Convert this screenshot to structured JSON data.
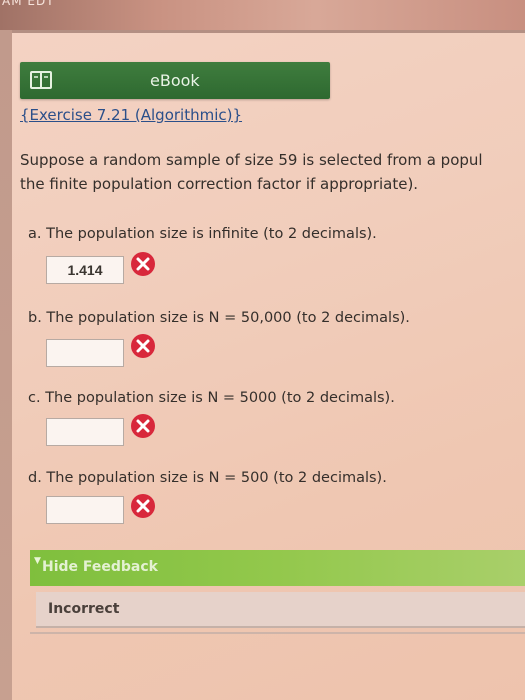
{
  "top_label": "AM EDT",
  "ebook": {
    "label": "eBook",
    "icon": "book-icon"
  },
  "exercise_title": "{Exercise 7.21 (Algorithmic)}",
  "question": {
    "line1": "Suppose a random sample of size 59 is selected from a popul",
    "line2": "the finite population correction factor if appropriate)."
  },
  "parts": [
    {
      "label": "a. The population size is infinite (to 2 decimals).",
      "value": "1.414",
      "status": "incorrect"
    },
    {
      "label": "b. The population size is N = 50,000 (to 2 decimals).",
      "value": "",
      "status": "incorrect"
    },
    {
      "label": "c. The population size is N = 5000 (to 2 decimals).",
      "value": "",
      "status": "incorrect"
    },
    {
      "label": "d. The population size is N = 500 (to 2 decimals).",
      "value": "",
      "status": "incorrect"
    }
  ],
  "feedback": {
    "toggle_label": "Hide Feedback",
    "result": "Incorrect"
  },
  "colors": {
    "ebook_green": "#2e6930",
    "feedback_green": "#93c84c",
    "error_red": "#d8283b",
    "link_blue": "#2b4f8a"
  }
}
